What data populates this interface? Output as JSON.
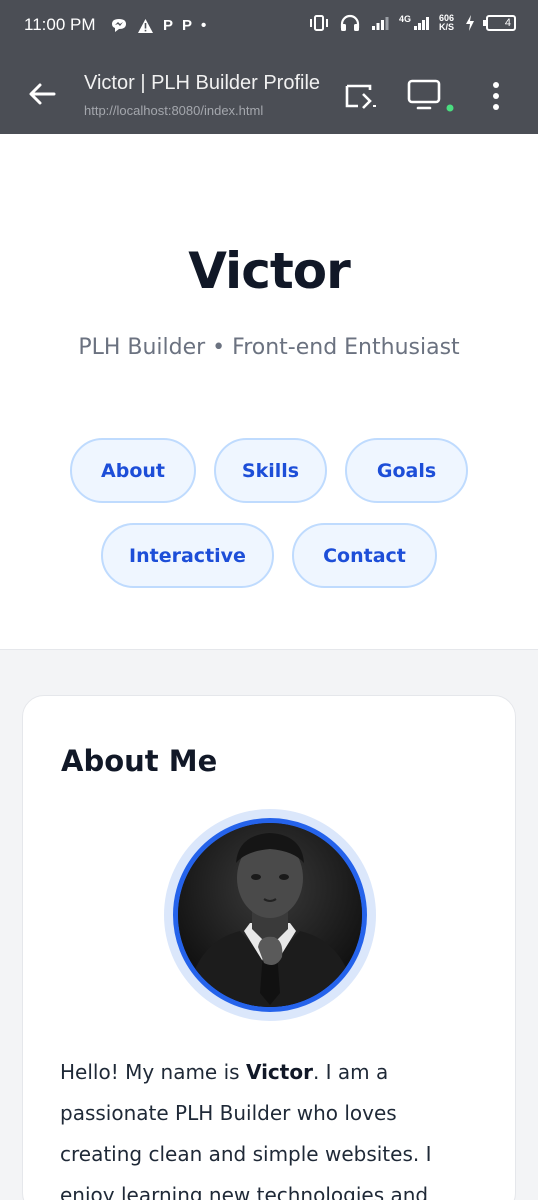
{
  "status_bar": {
    "time": "11:00 PM",
    "left_icons": [
      "messenger-icon",
      "warning-icon",
      "P",
      "P",
      "•"
    ],
    "network": "4G",
    "speed_value": "606",
    "speed_unit": "K/S",
    "battery": "4"
  },
  "browser": {
    "title": "Victor | PLH Builder Profile",
    "url": "http://localhost:8080/index.html"
  },
  "hero": {
    "name": "Victor",
    "subtitle": "PLH Builder • Front-end Enthusiast",
    "nav": [
      {
        "label": "About"
      },
      {
        "label": "Skills"
      },
      {
        "label": "Goals"
      },
      {
        "label": "Interactive"
      },
      {
        "label": "Contact"
      }
    ]
  },
  "about": {
    "title": "About Me",
    "text_before": "Hello! My name is ",
    "name_bold": "Victor",
    "text_after": ". I am a passionate PLH Builder who loves creating clean and simple websites. I enjoy learning new technologies and"
  },
  "colors": {
    "accent": "#1d4ed8",
    "pill_bg": "#eff6ff",
    "pill_border": "#bfdbfe",
    "chrome": "#4b4e55",
    "online_dot": "#4ade80"
  }
}
